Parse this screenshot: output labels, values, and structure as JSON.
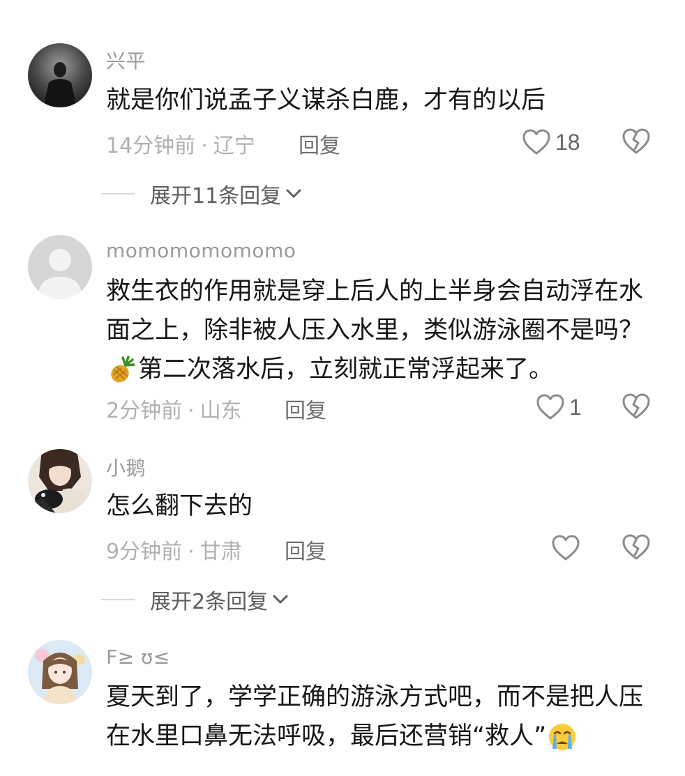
{
  "comments": [
    {
      "username": "兴平",
      "text": "就是你们说孟子义谋杀白鹿，才有的以后",
      "time": "14分钟前",
      "location": "辽宁",
      "reply_label": "回复",
      "likes": "18",
      "expand_label": "展开11条回复",
      "avatar_icon": "dark-figure-avatar"
    },
    {
      "username": "momomomomomo",
      "text_part1": "救生衣的作用就是穿上后人的上半身会自动浮在水面之上，除非被人压入水里，类似游泳圈不是吗？",
      "emoji_icon": "pineapple-emoji",
      "text_part2": "第二次落水后，立刻就正常浮起来了。",
      "time": "2分钟前",
      "location": "山东",
      "reply_label": "回复",
      "likes": "1",
      "avatar_icon": "default-gray-avatar"
    },
    {
      "username": "小鹅",
      "text": "怎么翻下去的",
      "time": "9分钟前",
      "location": "甘肃",
      "reply_label": "回复",
      "likes": "",
      "expand_label": "展开2条回复",
      "avatar_icon": "girl-with-cat-avatar"
    },
    {
      "username": "F≥ ʊ≤",
      "text_part1": "夏天到了，学学正确的游泳方式吧，而不是把人压在水里口鼻无法呼吸，最后还营销“救人”",
      "emoji_icon": "crying-face-emoji",
      "time": "",
      "location": "",
      "avatar_icon": "anime-girl-avatar"
    }
  ],
  "separator": "·",
  "colors": {
    "meta_gray": "#b0b0b0",
    "username_gray": "#9a9a9a",
    "text_black": "#161616",
    "icon_gray": "#8a8a8a"
  }
}
